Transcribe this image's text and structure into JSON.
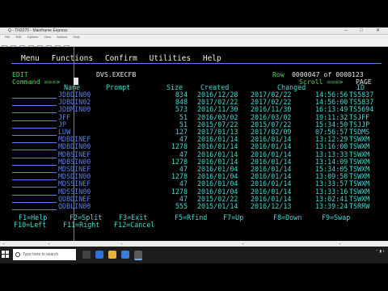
{
  "window": {
    "title": "Q - TN3270 - Mainframe Express",
    "menu": [
      "File",
      "Edit",
      "Options",
      "View",
      "Actions",
      "Help"
    ]
  },
  "menubar": {
    "items": [
      "Menu",
      "Functions",
      "Confirm",
      "Utilities",
      "Help"
    ]
  },
  "header": {
    "mode": "EDIT",
    "dataset": "DVS.EXECFB",
    "row_label": "Row",
    "row_value": "0000047 of 0000123",
    "command_label": "Command ===>",
    "scroll_label": "Scroll ===>",
    "scroll_value": "PAGE"
  },
  "columns": {
    "name": "Name",
    "prompt": "Prompt",
    "size": "Size",
    "created": "Created",
    "changed": "Changed",
    "id": "ID"
  },
  "rows": [
    {
      "name": "JDBDIN00",
      "size": "834",
      "created": "2016/12/28",
      "changed": "2017/02/22",
      "time": "14:56:56",
      "id": "TS5837"
    },
    {
      "name": "JDBDIN02",
      "size": "848",
      "created": "2017/02/22",
      "changed": "2017/02/22",
      "time": "14:56:00",
      "id": "TS5837"
    },
    {
      "name": "JDBMIN00",
      "size": "573",
      "created": "2016/11/30",
      "changed": "2016/11/30",
      "time": "16:13:49",
      "id": "TS5694"
    },
    {
      "name": "JFF",
      "size": "51",
      "created": "2016/03/02",
      "changed": "2016/03/02",
      "time": "19:11:32",
      "id": "TSJFF"
    },
    {
      "name": "JP",
      "size": "51",
      "created": "2015/07/22",
      "changed": "2015/07/22",
      "time": "15:34:50",
      "id": "TSJJP"
    },
    {
      "name": "LUW",
      "size": "127",
      "created": "2017/01/13",
      "changed": "2017/02/09",
      "time": "07:56:57",
      "id": "TSDMS"
    },
    {
      "name": "MDBDINEF",
      "size": "47",
      "created": "2016/01/14",
      "changed": "2016/01/14",
      "time": "13:12:29",
      "id": "TSWXM"
    },
    {
      "name": "MDBDIN00",
      "size": "1278",
      "created": "2016/01/14",
      "changed": "2016/01/14",
      "time": "13:16:00",
      "id": "TSWXM"
    },
    {
      "name": "MDBSINEF",
      "size": "47",
      "created": "2016/01/14",
      "changed": "2016/01/14",
      "time": "13:13:33",
      "id": "TSWXM"
    },
    {
      "name": "MDBSIN00",
      "size": "1278",
      "created": "2016/01/14",
      "changed": "2016/01/14",
      "time": "13:14:09",
      "id": "TSWXM"
    },
    {
      "name": "MDSDINEF",
      "size": "47",
      "created": "2016/01/04",
      "changed": "2016/01/14",
      "time": "15:34:05",
      "id": "TSWXM"
    },
    {
      "name": "MDSDIN00",
      "size": "1278",
      "created": "2016/01/04",
      "changed": "2016/01/14",
      "time": "13:09:58",
      "id": "TSWXM"
    },
    {
      "name": "MDSSINEF",
      "size": "47",
      "created": "2016/01/04",
      "changed": "2016/01/14",
      "time": "13:33:57",
      "id": "TSWXM"
    },
    {
      "name": "MDSSIN00",
      "size": "1278",
      "created": "2016/01/04",
      "changed": "2016/01/14",
      "time": "13:33:16",
      "id": "TSWXM"
    },
    {
      "name": "QDBDINEF",
      "size": "47",
      "created": "2015/02/22",
      "changed": "2016/01/14",
      "time": "13:02:41",
      "id": "TSWXM"
    },
    {
      "name": "QDBLIN00",
      "size": "555",
      "created": "2015/01/14",
      "changed": "2016/12/13",
      "time": "13:39:24",
      "id": "TSRRW"
    }
  ],
  "fkeys": {
    "f1": "F1=Help",
    "f2": "F2=Split",
    "f3": "F3=Exit",
    "f5": "F5=Rfind",
    "f7": "F7=Up",
    "f8": "F8=Down",
    "f9": "F9=Swap",
    "f10": "F10=Left",
    "f11": "F11=Right",
    "f12": "F12=Cancel"
  },
  "colors": {
    "green": "#56d356",
    "cyan": "#48d7d2",
    "blue": "#5b7fe6",
    "white": "#e6e6e6",
    "background": "#000000"
  },
  "taskbar": {
    "search_placeholder": "Type here to search"
  }
}
